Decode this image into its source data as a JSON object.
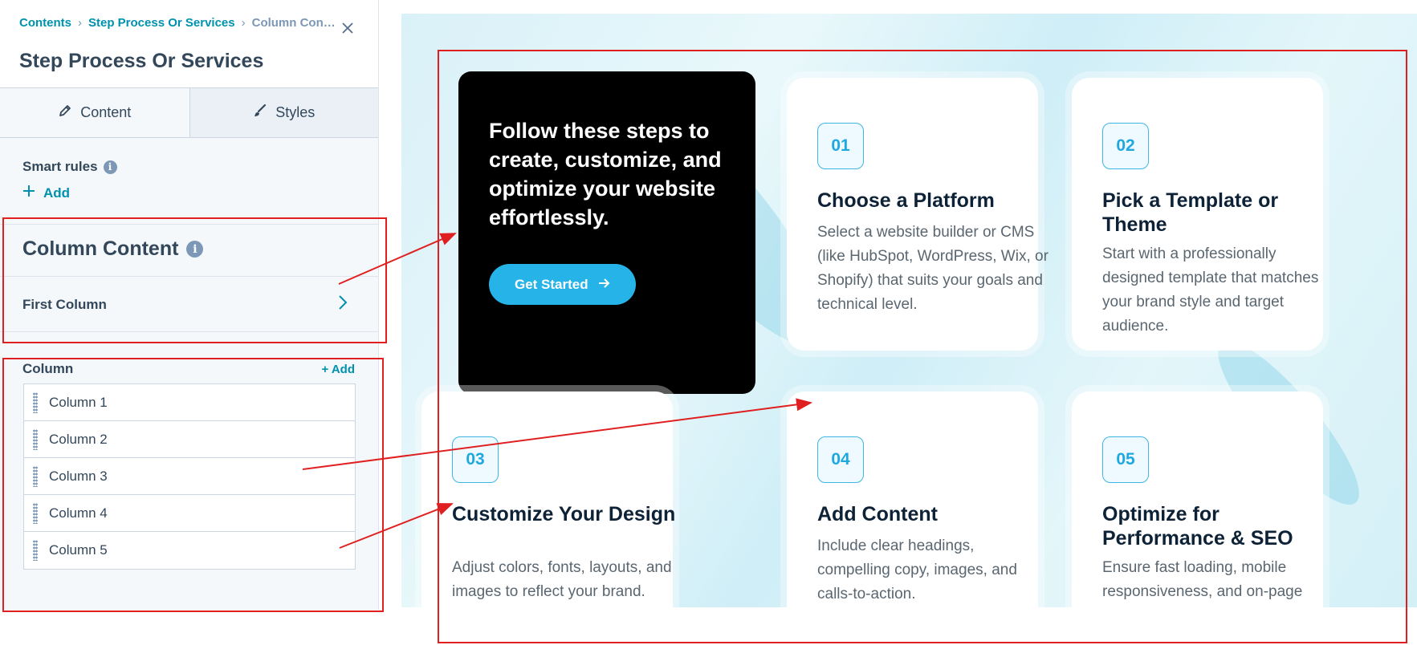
{
  "sidebar": {
    "breadcrumb": [
      "Contents",
      "Step Process Or Services",
      "Column Con…"
    ],
    "title": "Step Process Or Services",
    "tabs": [
      {
        "label": "Content",
        "icon": "pencil-icon",
        "active": true
      },
      {
        "label": "Styles",
        "icon": "brush-icon",
        "active": false
      }
    ],
    "smart_rules": {
      "label": "Smart rules",
      "add_label": "Add"
    },
    "column_content": {
      "title": "Column Content",
      "first_column_label": "First Column"
    },
    "column_list": {
      "label": "Column",
      "add_label": "+ Add",
      "items": [
        "Column 1",
        "Column 2",
        "Column 3",
        "Column 4",
        "Column 5"
      ]
    }
  },
  "preview": {
    "hero": {
      "text": "Follow these steps to create, customize, and optimize your website effortlessly.",
      "button_label": "Get Started"
    },
    "steps": [
      {
        "number": "01",
        "title": "Choose a Platform",
        "description": "Select a website builder or CMS (like HubSpot, WordPress, Wix, or Shopify) that suits your goals and technical level."
      },
      {
        "number": "02",
        "title": "Pick a Template or Theme",
        "description": "Start with a professionally designed template that matches your brand style and target audience."
      },
      {
        "number": "03",
        "title": "Customize Your Design",
        "description": "Adjust colors, fonts, layouts, and images to reflect your brand."
      },
      {
        "number": "04",
        "title": "Add Content",
        "description": "Include clear headings, compelling copy, images, and calls-to-action."
      },
      {
        "number": "05",
        "title": "Optimize for Performance & SEO",
        "description": "Ensure fast loading, mobile responsiveness, and on-page SEO best practices."
      }
    ]
  },
  "colors": {
    "accent": "#0091ae",
    "annotation_red": "#e02020",
    "hero_bg": "#000000",
    "button_bg": "#26b3e8"
  }
}
